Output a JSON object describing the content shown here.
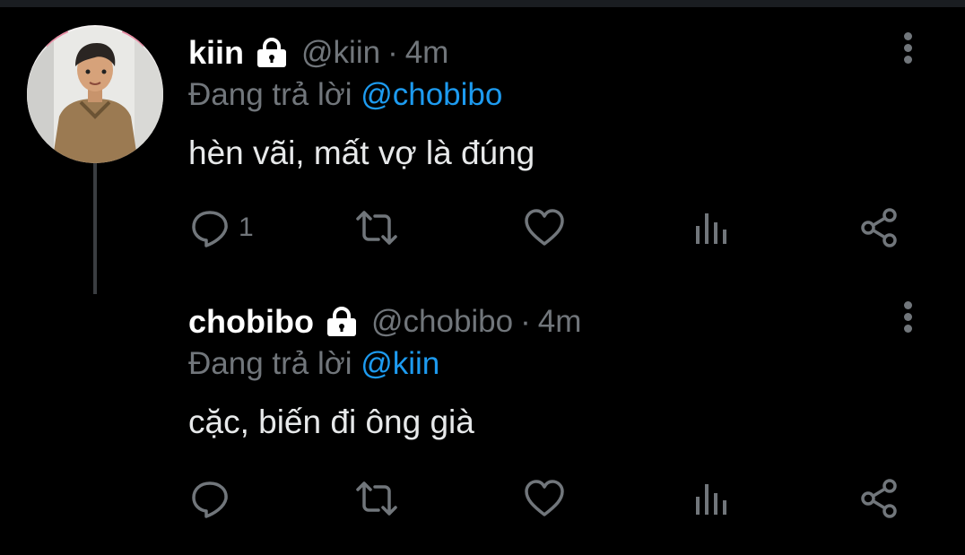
{
  "tweets": [
    {
      "display_name": "kiin",
      "handle": "@kiin",
      "separator": "·",
      "time": "4m",
      "replying_prefix": "Đang trả lời",
      "replying_to": "@chobibo",
      "text": "hèn vãi, mất vợ là đúng",
      "reply_count": "1",
      "icons": [
        "lock-icon",
        "more-vertical-icon",
        "reply-icon",
        "retweet-icon",
        "like-icon",
        "analytics-icon",
        "share-icon"
      ]
    },
    {
      "display_name": "chobibo",
      "handle": "@chobibo",
      "separator": "·",
      "time": "4m",
      "replying_prefix": "Đang trả lời",
      "replying_to": "@kiin",
      "text": "cặc, biến đi ông già",
      "reply_count": "",
      "icons": [
        "lock-icon",
        "more-vertical-icon",
        "reply-icon",
        "retweet-icon",
        "like-icon",
        "analytics-icon",
        "share-icon"
      ]
    }
  ],
  "colors": {
    "background": "#000000",
    "muted": "#71767b",
    "accent": "#1d9bf0",
    "text": "#e7e9ea"
  }
}
